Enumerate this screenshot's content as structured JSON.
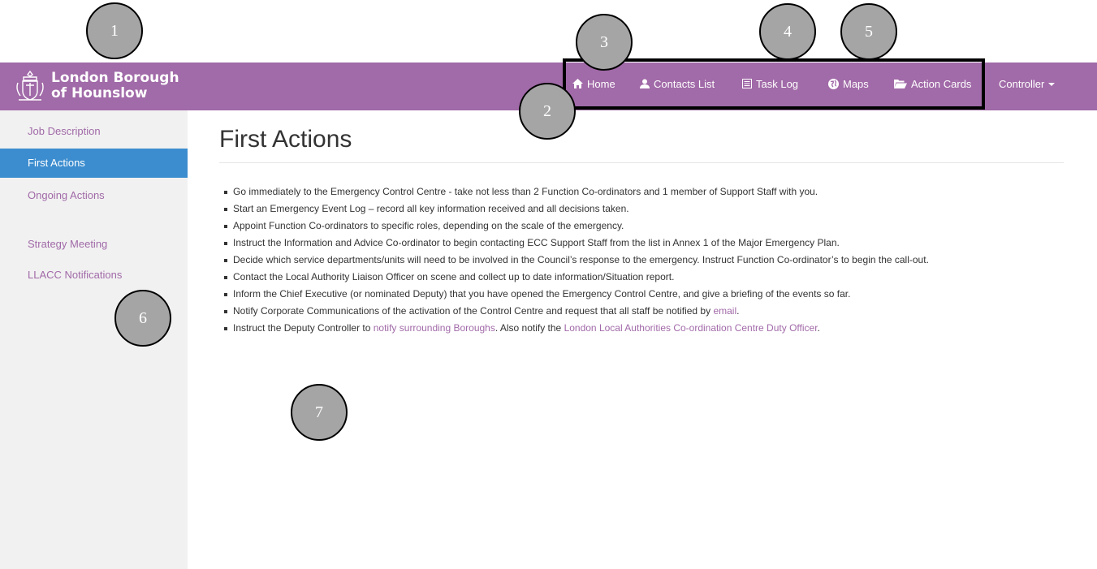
{
  "brand": {
    "line1": "London Borough",
    "line2": "of Hounslow",
    "crest_icon": "borough-crest-icon"
  },
  "nav": {
    "items": [
      {
        "label": "Home",
        "icon": "home-icon"
      },
      {
        "label": "Contacts List",
        "icon": "user-icon"
      },
      {
        "label": "Task Log",
        "icon": "list-icon"
      },
      {
        "label": "Maps",
        "icon": "globe-icon"
      },
      {
        "label": "Action Cards",
        "icon": "folder-open-icon"
      }
    ],
    "user_menu": {
      "label": "Controller",
      "icon": "caret-down-icon"
    }
  },
  "sidebar": {
    "items": [
      {
        "label": "Job Description",
        "active": false
      },
      {
        "label": "First Actions",
        "active": true
      },
      {
        "label": "Ongoing Actions",
        "active": false
      },
      {
        "label": "Strategy Meeting",
        "active": false
      },
      {
        "label": "LLACC Notifications",
        "active": false
      }
    ]
  },
  "main": {
    "title": "First Actions",
    "actions": [
      {
        "text": "Go immediately to the Emergency Control Centre - take not less than 2 Function Co-ordinators and 1 member of Support Staff with you."
      },
      {
        "text": "Start an Emergency Event Log – record all key information received and all decisions taken."
      },
      {
        "text": "Appoint Function Co-ordinators to specific roles, depending on the scale of the emergency."
      },
      {
        "text": "Instruct the Information and Advice Co-ordinator to begin contacting ECC Support Staff from the list in Annex 1 of the Major Emergency Plan."
      },
      {
        "text": "Decide which service departments/units will need to be involved in the Council’s response to the emergency. Instruct Function Co-ordinator’s to begin the call-out."
      },
      {
        "text": "Contact the Local Authority Liaison Officer on scene and collect up to date information/Situation report."
      },
      {
        "text": "Inform the Chief Executive (or nominated Deputy) that you have opened the Emergency Control Centre, and give a briefing of the events so far."
      },
      {
        "text": "Notify Corporate Communications of the activation of the Control Centre and request that all staff be notified by ",
        "link": "email",
        "after": "."
      },
      {
        "text": "Instruct the Deputy Controller to ",
        "link": "notify surrounding Boroughs",
        "after": ". Also notify the ",
        "link2": "London Local Authorities Co-ordination Centre Duty Officer",
        "after2": "."
      }
    ]
  },
  "callouts": [
    "1",
    "2",
    "3",
    "4",
    "5",
    "6",
    "7"
  ],
  "colors": {
    "brand": "#a16aa8",
    "active": "#3c8dcf",
    "sidebar_bg": "#f1f1f1",
    "callout": "#a5a5a5"
  }
}
